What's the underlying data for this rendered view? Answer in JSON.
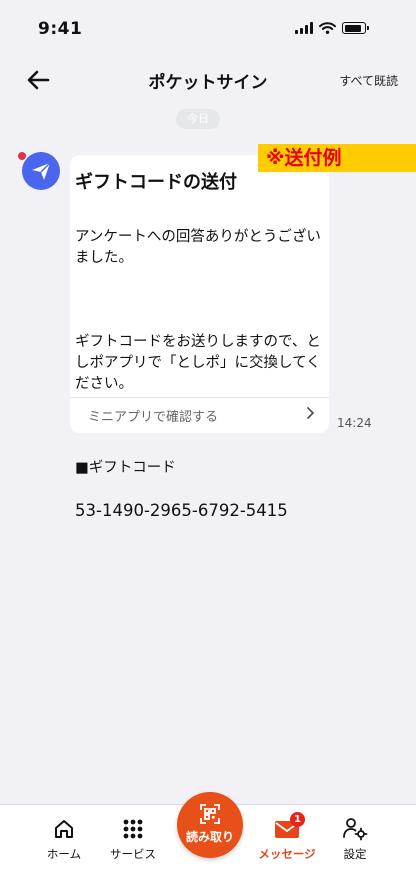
{
  "status_bar": {
    "time": "9:41"
  },
  "header": {
    "title": "ポケットサイン",
    "read_all": "すべて既読"
  },
  "date_chip": "今日",
  "message": {
    "tag": "※送付例",
    "title": "ギフトコードの送付",
    "body_p1": "アンケートへの回答ありがとうございました。",
    "body_p2": "ギフトコードをお送りしますので、としポアプリで「としポ」に交換してください。",
    "code_label": "■ギフトコード",
    "code": "53-1490-2965-6792-5415",
    "link": "ミニアプリで確認する",
    "time": "14:24"
  },
  "tabs": {
    "home": "ホーム",
    "services": "サービス",
    "scan": "読み取り",
    "messages": "メッセージ",
    "settings": "設定",
    "message_badge": "1"
  },
  "colors": {
    "accent": "#e8501a",
    "avatar": "#4b66ee",
    "tag_bg": "#ffcc00",
    "tag_text": "#e60012"
  },
  "icons": [
    "back-arrow-icon",
    "paper-plane-icon",
    "chevron-right-icon",
    "home-icon",
    "grid-icon",
    "qr-scan-icon",
    "mail-icon",
    "user-settings-icon"
  ]
}
